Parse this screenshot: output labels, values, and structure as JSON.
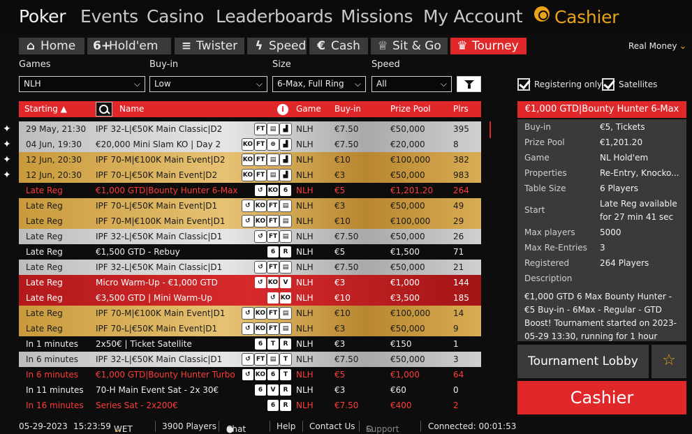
{
  "nav": {
    "items": [
      "Poker",
      "Events",
      "Casino",
      "Leaderboards",
      "Missions",
      "My Account"
    ],
    "cashier": "Cashier"
  },
  "tabs": [
    {
      "icon": "home-icon",
      "glyph": "⌂",
      "label": "Home"
    },
    {
      "icon": "six-plus-icon",
      "glyph": "6+",
      "label": "Hold'em"
    },
    {
      "icon": "twister-icon",
      "glyph": "≡",
      "label": "Twister"
    },
    {
      "icon": "lightning-icon",
      "glyph": "ϟ",
      "label": "Speed"
    },
    {
      "icon": "euro-coin-icon",
      "glyph": "€",
      "label": "Cash"
    },
    {
      "icon": "trophy-icon",
      "glyph": "♕",
      "label": "Sit & Go"
    },
    {
      "icon": "cup-icon",
      "glyph": "♛",
      "label": "Tourney"
    }
  ],
  "real_money": "Real Money",
  "filters": {
    "games": {
      "label": "Games",
      "value": "NLH"
    },
    "buyin": {
      "label": "Buy-in",
      "value": "Low"
    },
    "size": {
      "label": "Size",
      "value": "6-Max, Full Ring"
    },
    "speed": {
      "label": "Speed",
      "value": "All"
    }
  },
  "checkboxes": {
    "registering_only": "Registering only",
    "satellites": "Satellites"
  },
  "table": {
    "headers": {
      "starting": "Starting ▲",
      "name": "Name",
      "game": "Game",
      "buyin": "Buy-in",
      "prize": "Prize Pool",
      "plrs": "Plrs"
    },
    "rows": [
      {
        "style": "silver",
        "start": "29 May, 21:30",
        "name": "IPF 32-L|€50K Main Classic|D2",
        "badges": [
          "FT",
          "▤",
          "▟"
        ],
        "game": "NLH",
        "buyin": "€7.50",
        "prize": "€50,000",
        "plrs": "395"
      },
      {
        "style": "silver",
        "start": "04 Jun, 19:30",
        "name": "€20,000 Mini Slam KO | Day 2",
        "badges": [
          "KO",
          "FT",
          "⊛",
          "▟"
        ],
        "game": "NLH",
        "buyin": "€7.50",
        "prize": "€20,000",
        "plrs": "8"
      },
      {
        "style": "gold",
        "start": "12 Jun, 20:30",
        "name": "IPF 70-M|€100K Main Event|D2",
        "badges": [
          "KO",
          "FT",
          "▤",
          "▟"
        ],
        "game": "NLH",
        "buyin": "€10",
        "prize": "€100,000",
        "plrs": "382"
      },
      {
        "style": "gold",
        "start": "12 Jun, 20:30",
        "name": "IPF 70-L|€50K Main Event|D2",
        "badges": [
          "KO",
          "FT",
          "▤",
          "▟"
        ],
        "game": "NLH",
        "buyin": "€3",
        "prize": "€50,000",
        "plrs": "983"
      },
      {
        "style": "redtext",
        "start": "Late Reg",
        "name": "€1,000 GTD|Bounty Hunter 6-Max",
        "badges": [
          "↺",
          "KO",
          "6"
        ],
        "game": "NLH",
        "buyin": "€5",
        "prize": "€1,201.20",
        "plrs": "264"
      },
      {
        "style": "gold",
        "start": "Late Reg",
        "name": "IPF 70-L|€50K Main Event|D1",
        "badges": [
          "↺",
          "KO",
          "FT",
          "▤"
        ],
        "game": "NLH",
        "buyin": "€3",
        "prize": "€50,000",
        "plrs": "49"
      },
      {
        "style": "gold",
        "start": "Late Reg",
        "name": "IPF 70-M|€100K Main Event|D1",
        "badges": [
          "↺",
          "KO",
          "FT",
          "▤"
        ],
        "game": "NLH",
        "buyin": "€10",
        "prize": "€100,000",
        "plrs": "29"
      },
      {
        "style": "silver",
        "start": "Late Reg",
        "name": "IPF 32-L|€50K Main Classic|D1",
        "badges": [
          "↺",
          "FT",
          "▤"
        ],
        "game": "NLH",
        "buyin": "€7.50",
        "prize": "€50,000",
        "plrs": "26"
      },
      {
        "style": "plain",
        "start": "Late Reg",
        "name": "€1,500 GTD - Rebuy",
        "badges": [
          "6",
          "R"
        ],
        "game": "NLH",
        "buyin": "€5",
        "prize": "€1,500",
        "plrs": "71"
      },
      {
        "style": "silver",
        "start": "Late Reg",
        "name": "IPF 32-L|€50K Main Classic|D1",
        "badges": [
          "↺",
          "FT",
          "▤"
        ],
        "game": "NLH",
        "buyin": "€7.50",
        "prize": "€50,000",
        "plrs": "21"
      },
      {
        "style": "redbg",
        "start": "Late Reg",
        "name": "Micro Warm-Up - €1,000 GTD",
        "badges": [
          "↺",
          "KO",
          "V"
        ],
        "game": "NLH",
        "buyin": "€3",
        "prize": "€1,000",
        "plrs": "144"
      },
      {
        "style": "redbg",
        "start": "Late Reg",
        "name": "€3,500 GTD | Mini Warm-Up",
        "badges": [
          "↺",
          "KO"
        ],
        "game": "NLH",
        "buyin": "€10",
        "prize": "€3,500",
        "plrs": "185"
      },
      {
        "style": "gold",
        "start": "Late Reg",
        "name": "IPF 70-M|€100K Main Event|D1",
        "badges": [
          "↺",
          "KO",
          "FT",
          "▤"
        ],
        "game": "NLH",
        "buyin": "€10",
        "prize": "€100,000",
        "plrs": "14"
      },
      {
        "style": "gold",
        "start": "Late Reg",
        "name": "IPF 70-L|€50K Main Event|D1",
        "badges": [
          "↺",
          "KO",
          "FT",
          "▤"
        ],
        "game": "NLH",
        "buyin": "€3",
        "prize": "€50,000",
        "plrs": "9"
      },
      {
        "style": "plain",
        "start": "In 1 minutes",
        "name": "2x50€ | Ticket Satellite",
        "badges": [
          "6",
          "T",
          "R"
        ],
        "game": "NLH",
        "buyin": "€3",
        "prize": "€150",
        "plrs": "1"
      },
      {
        "style": "silver",
        "start": "In 6 minutes",
        "name": "IPF 32-L|€50K Main Classic|D1",
        "badges": [
          "↺",
          "FT",
          "▤",
          "T"
        ],
        "game": "NLH",
        "buyin": "€7.50",
        "prize": "€50,000",
        "plrs": "3"
      },
      {
        "style": "redtext",
        "start": "In 6 minutes",
        "name": "€1,000 GTD|Bounty Hunter Turbo",
        "badges": [
          "↺",
          "KO",
          "6",
          "T"
        ],
        "game": "NLH",
        "buyin": "€5",
        "prize": "€1,000",
        "plrs": "64"
      },
      {
        "style": "plain",
        "start": "In 11 minutes",
        "name": "70-H Main Event Sat - 2x 30€",
        "badges": [
          "6",
          "V",
          "R"
        ],
        "game": "NLH",
        "buyin": "€3",
        "prize": "€60",
        "plrs": "0"
      },
      {
        "style": "redtext",
        "start": "In 16 minutes",
        "name": "Series Sat - 2x200€",
        "badges": [
          "6",
          "R"
        ],
        "game": "NLH",
        "buyin": "€7.50",
        "prize": "€400",
        "plrs": "2"
      }
    ]
  },
  "detail": {
    "title": "€1,000 GTD|Bounty Hunter 6-Max",
    "fields": [
      {
        "label": "Buy-in",
        "value": "€5, Tickets"
      },
      {
        "label": "Prize Pool",
        "value": "€1,201.20"
      },
      {
        "label": "Game",
        "value": "NL Hold'em"
      },
      {
        "label": "Properties",
        "value": "Re-Entry, Knocko..."
      },
      {
        "label": "Table Size",
        "value": "6 Players"
      },
      {
        "label": "Start",
        "value": "Late Reg available",
        "value2": "for 27 min 41 sec"
      },
      {
        "label": "Max players",
        "value": "5000"
      },
      {
        "label": "Max Re-Entries",
        "value": "3"
      },
      {
        "label": "Registered",
        "value": "264 Players"
      }
    ],
    "description_label": "Description",
    "description": "€1,000 GTD 6 Max Bounty Hunter - €5 Buy-in - 6Max - Regular - GTD Boost! Tournament started on 2023-05-29 13:30, running for 1 hour",
    "lobby_button": "Tournament Lobby",
    "cashier_button": "Cashier"
  },
  "footer": {
    "date": "05-29-2023",
    "time": "15:23:59",
    "tz": "WET",
    "players": "3900 Players",
    "chat": "Chat",
    "help": "Help",
    "contact": "Contact Us",
    "support": "Support",
    "connected": "Connected: 00:01:53"
  }
}
